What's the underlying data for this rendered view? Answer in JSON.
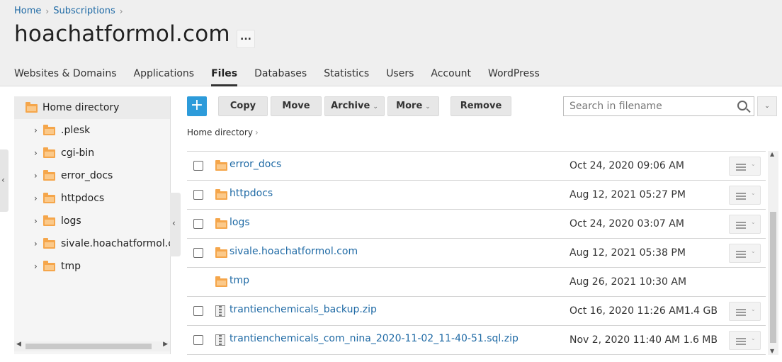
{
  "breadcrumb": {
    "items": [
      "Home",
      "Subscriptions"
    ]
  },
  "page": {
    "title": "hoachatformol.com",
    "more_label": "..."
  },
  "tabs": [
    {
      "label": "Websites & Domains"
    },
    {
      "label": "Applications"
    },
    {
      "label": "Files",
      "active": true
    },
    {
      "label": "Databases"
    },
    {
      "label": "Statistics"
    },
    {
      "label": "Users"
    },
    {
      "label": "Account"
    },
    {
      "label": "WordPress"
    }
  ],
  "tree": {
    "root": "Home directory",
    "items": [
      {
        "label": ".plesk"
      },
      {
        "label": "cgi-bin"
      },
      {
        "label": "error_docs"
      },
      {
        "label": "httpdocs"
      },
      {
        "label": "logs"
      },
      {
        "label": "sivale.hoachatformol.com"
      },
      {
        "label": "tmp"
      }
    ]
  },
  "toolbar": {
    "add_label": "+",
    "copy_label": "Copy",
    "move_label": "Move",
    "archive_label": "Archive",
    "more_label": "More",
    "remove_label": "Remove",
    "dropdown_glyph": "⌄"
  },
  "search": {
    "placeholder": "Search in filename",
    "value": ""
  },
  "path": {
    "current": "Home directory"
  },
  "files": [
    {
      "name": "error_docs",
      "type": "folder",
      "date": "Oct 24, 2020 09:06 AM",
      "size": "",
      "checkbox": true,
      "menu": true
    },
    {
      "name": "httpdocs",
      "type": "folder",
      "date": "Aug 12, 2021 05:27 PM",
      "size": "",
      "checkbox": true,
      "menu": true
    },
    {
      "name": "logs",
      "type": "folder",
      "date": "Oct 24, 2020 03:07 AM",
      "size": "",
      "checkbox": true,
      "menu": true
    },
    {
      "name": "sivale.hoachatformol.com",
      "type": "folder",
      "date": "Aug 12, 2021 05:38 PM",
      "size": "",
      "checkbox": true,
      "menu": true
    },
    {
      "name": "tmp",
      "type": "folder",
      "date": "Aug 26, 2021 10:30 AM",
      "size": "",
      "checkbox": false,
      "menu": false
    },
    {
      "name": "trantienchemicals_backup.zip",
      "type": "zip",
      "date": "Oct 16, 2020 11:26 AM",
      "size": "1.4 GB",
      "checkbox": true,
      "menu": true
    },
    {
      "name": "trantienchemicals_com_nina_2020-11-02_11-40-51.sql.zip",
      "type": "zip",
      "date": "Nov 2, 2020 11:40 AM",
      "size": "1.6 MB",
      "checkbox": true,
      "menu": true
    }
  ],
  "colors": {
    "accent": "#2d9bda",
    "link": "#1f6aa5",
    "folder": "#f5a64b"
  }
}
